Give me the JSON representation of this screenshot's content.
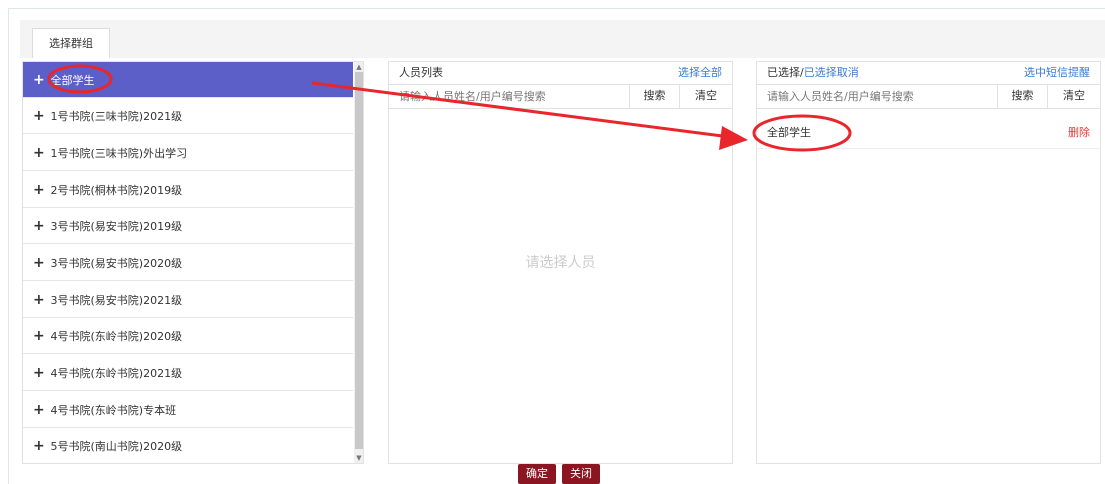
{
  "tab": {
    "label": "选择群组"
  },
  "groups": [
    {
      "label": "全部学生",
      "active": true
    },
    {
      "label": "1号书院(三味书院)2021级"
    },
    {
      "label": "1号书院(三味书院)外出学习"
    },
    {
      "label": "2号书院(桐林书院)2019级"
    },
    {
      "label": "3号书院(易安书院)2019级"
    },
    {
      "label": "3号书院(易安书院)2020级"
    },
    {
      "label": "3号书院(易安书院)2021级"
    },
    {
      "label": "4号书院(东岭书院)2020级"
    },
    {
      "label": "4号书院(东岭书院)2021级"
    },
    {
      "label": "4号书院(东岭书院)专本班"
    },
    {
      "label": "5号书院(南山书院)2020级"
    }
  ],
  "plus_icon": "+",
  "people_panel": {
    "title": "人员列表",
    "select_all": "选择全部",
    "search_placeholder": "请输入人员姓名/用户编号搜索",
    "search_btn": "搜索",
    "clear_btn": "清空",
    "empty_text": "请选择人员"
  },
  "selected_panel": {
    "title_prefix": "已选择/",
    "cancel_link": "已选择取消",
    "sms_link": "选中短信提醒",
    "search_placeholder": "请输入人员姓名/用户编号搜索",
    "search_btn": "搜索",
    "clear_btn": "清空",
    "selected_item": "全部学生",
    "delete_label": "删除"
  },
  "footer": {
    "confirm": "确定",
    "close": "关闭"
  },
  "colors": {
    "active_group": "#5b5fc7",
    "link": "#3a7bd5",
    "delete": "#e23b3b",
    "button": "#8b1520",
    "annotation": "#e8262b"
  }
}
